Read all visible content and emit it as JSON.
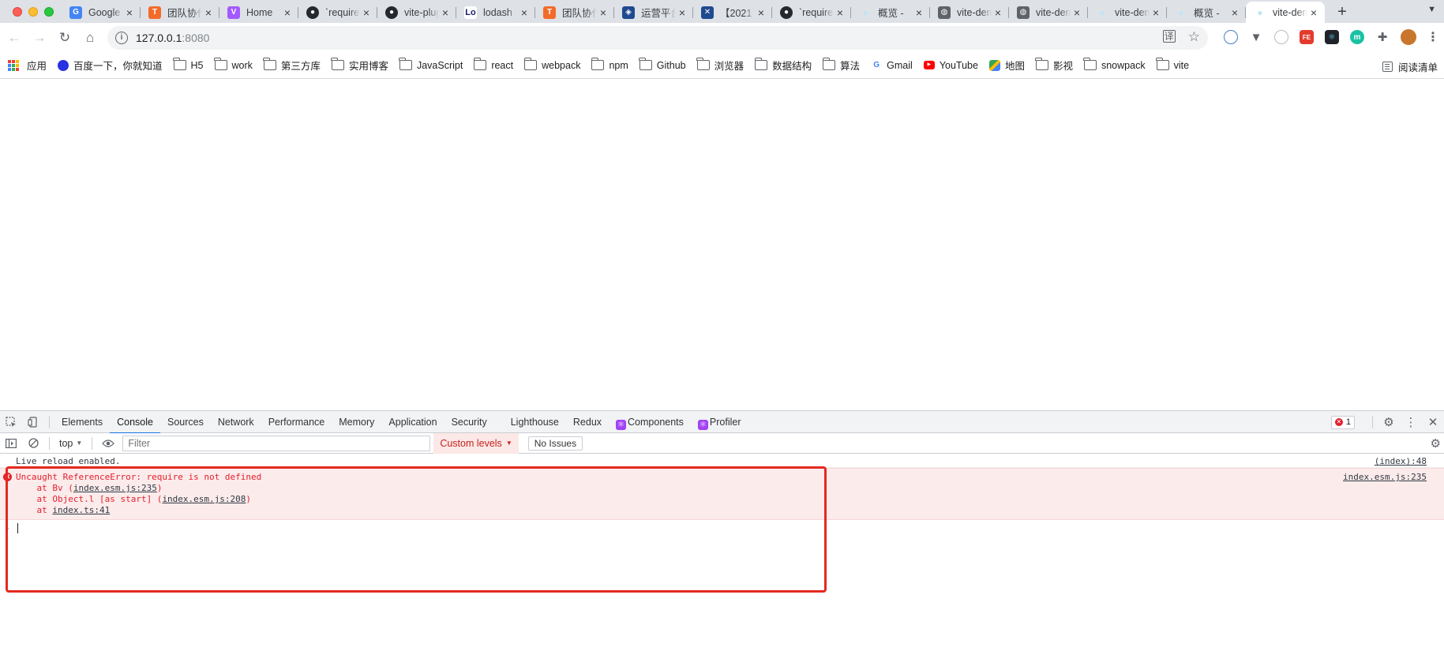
{
  "browser": {
    "tabs": [
      {
        "title": "Google",
        "fav_color": "#4285f4",
        "fav_glyph": "G"
      },
      {
        "title": "团队协作",
        "fav_color": "#f36b2a",
        "fav_glyph": "T"
      },
      {
        "title": "Home",
        "fav_color": "#a259ff",
        "fav_glyph": "V"
      },
      {
        "title": "`require",
        "fav_color": "#24292e",
        "fav_glyph": "●"
      },
      {
        "title": "vite-plugin",
        "fav_color": "#24292e",
        "fav_glyph": "●"
      },
      {
        "title": "lodash",
        "fav_color": "#ffffff",
        "fav_glyph": "Lo"
      },
      {
        "title": "团队协作",
        "fav_color": "#f36b2a",
        "fav_glyph": "T"
      },
      {
        "title": "运营平台",
        "fav_color": "#1f4a8f",
        "fav_glyph": "◈"
      },
      {
        "title": "【2021",
        "fav_color": "#1f4a8f",
        "fav_glyph": "✕"
      },
      {
        "title": "`require",
        "fav_color": "#24292e",
        "fav_glyph": "●"
      },
      {
        "title": "概览 -",
        "fav_color": "#bfe6f5",
        "fav_glyph": "●"
      },
      {
        "title": "vite-demo",
        "fav_color": "#5f6368",
        "fav_glyph": "◍"
      },
      {
        "title": "vite-demo",
        "fav_color": "#5f6368",
        "fav_glyph": "◍"
      },
      {
        "title": "vite-demo",
        "fav_color": "#bfe6f5",
        "fav_glyph": "●"
      },
      {
        "title": "概览 -",
        "fav_color": "#bfe6f5",
        "fav_glyph": "●"
      },
      {
        "title": "vite-demo",
        "fav_color": "#bfe6f5",
        "fav_glyph": "●",
        "active": true
      }
    ],
    "close_glyph": "×",
    "new_tab_glyph": "+",
    "tab_menu_glyph": "▼",
    "address": {
      "host": "127.0.0.1",
      "port": ":8080",
      "info_glyph": "i"
    },
    "nav": {
      "back_glyph": "←",
      "forward_glyph": "→",
      "reload_glyph": "↻",
      "home_glyph": "⌂"
    },
    "omnibox_icons": {
      "translate": "译",
      "star": "☆"
    },
    "menu_glyph": "⋮"
  },
  "bookmarks": {
    "apps_label": "应用",
    "items": [
      {
        "label": "百度一下，你就知道",
        "icon": "baidu-icon"
      },
      {
        "label": "H5",
        "icon": "folder-icon"
      },
      {
        "label": "work",
        "icon": "folder-icon"
      },
      {
        "label": "第三方库",
        "icon": "folder-icon"
      },
      {
        "label": "实用博客",
        "icon": "folder-icon"
      },
      {
        "label": "JavaScript",
        "icon": "folder-icon"
      },
      {
        "label": "react",
        "icon": "folder-icon"
      },
      {
        "label": "webpack",
        "icon": "folder-icon"
      },
      {
        "label": "npm",
        "icon": "folder-icon"
      },
      {
        "label": "Github",
        "icon": "folder-icon"
      },
      {
        "label": "浏览器",
        "icon": "folder-icon"
      },
      {
        "label": "数据结构",
        "icon": "folder-icon"
      },
      {
        "label": "算法",
        "icon": "folder-icon"
      },
      {
        "label": "Gmail",
        "icon": "google-icon"
      },
      {
        "label": "YouTube",
        "icon": "youtube-icon"
      },
      {
        "label": "地图",
        "icon": "maps-icon"
      },
      {
        "label": "影视",
        "icon": "folder-icon"
      },
      {
        "label": "snowpack",
        "icon": "folder-icon"
      },
      {
        "label": "vite",
        "icon": "folder-icon"
      }
    ],
    "reading_list": "阅读清单"
  },
  "devtools": {
    "tabs": [
      "Elements",
      "Console",
      "Sources",
      "Network",
      "Performance",
      "Memory",
      "Application",
      "Security",
      "Lighthouse",
      "Redux",
      "Components",
      "Profiler"
    ],
    "active_tab": "Console",
    "error_count": "1",
    "context": "top",
    "filter_placeholder": "Filter",
    "levels_label": "Custom levels",
    "issues_label": "No Issues",
    "messages": {
      "info": {
        "text": "Live reload enabled.",
        "source": "(index):48"
      },
      "error": {
        "line1": "Uncaught ReferenceError: require is not defined",
        "line2_prefix": "    at Bv (",
        "line2_link": "index.esm.js:235",
        "line2_suffix": ")",
        "line3_prefix": "    at Object.l [as start] (",
        "line3_link": "index.esm.js:208",
        "line3_suffix": ")",
        "line4_prefix": "    at ",
        "line4_link": "index.ts:41",
        "source": "index.esm.js:235"
      }
    },
    "prompt_glyph": "›"
  },
  "colors": {
    "highlight": "#e3291f",
    "error": "#e41e2c",
    "accent": "#1a73e8"
  }
}
